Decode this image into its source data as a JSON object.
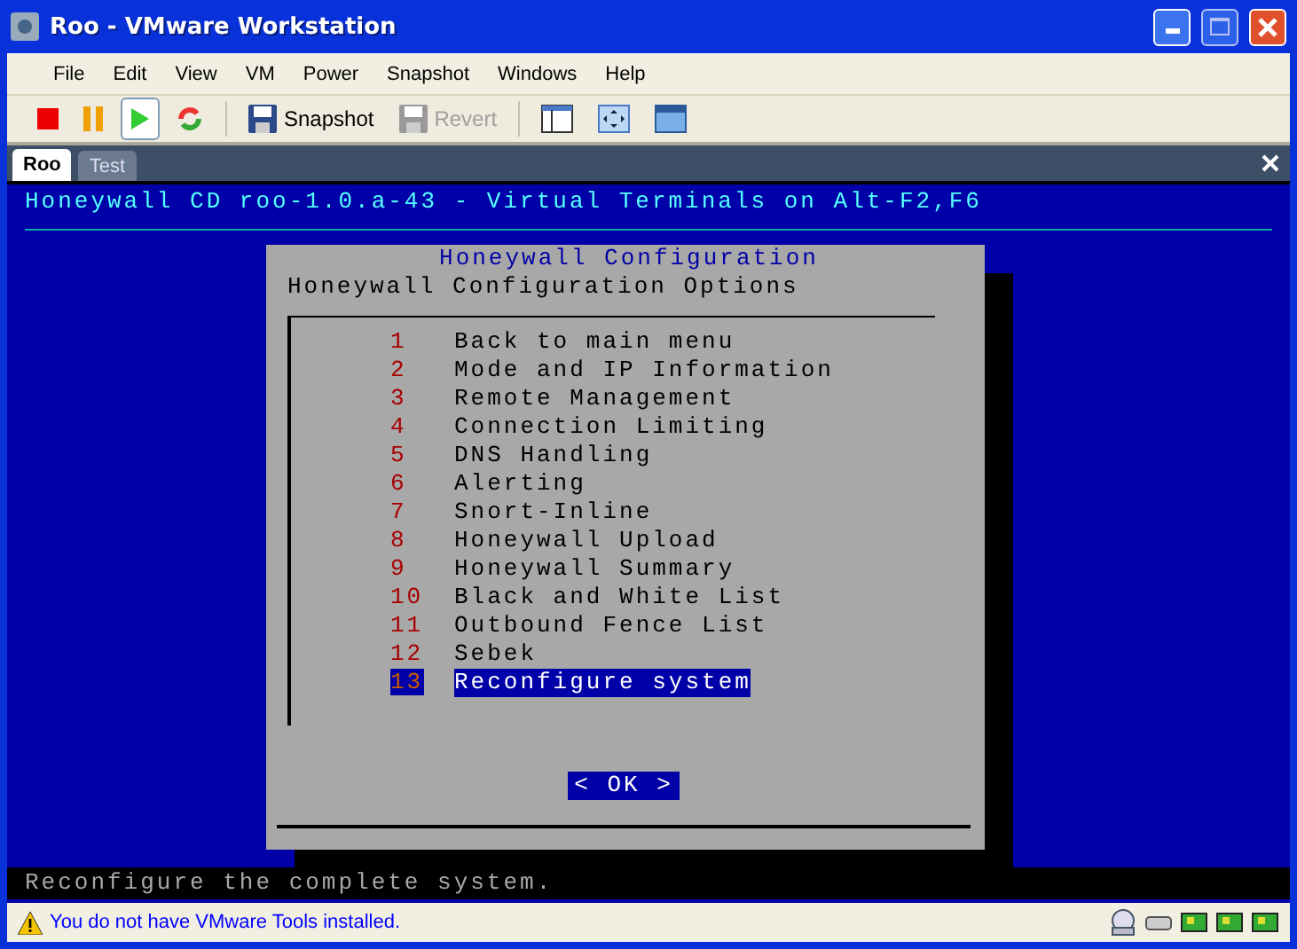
{
  "window": {
    "title": "Roo - VMware Workstation"
  },
  "menu": [
    "File",
    "Edit",
    "View",
    "VM",
    "Power",
    "Snapshot",
    "Windows",
    "Help"
  ],
  "toolbar": [
    {
      "kind": "stop"
    },
    {
      "kind": "pause"
    },
    {
      "kind": "play"
    },
    {
      "kind": "reset"
    },
    {
      "kind": "snapshot",
      "label": "Snapshot",
      "disabled": false
    },
    {
      "kind": "revert",
      "label": "Revert",
      "disabled": true
    },
    {
      "kind": "sidebar"
    },
    {
      "kind": "fullscreen"
    },
    {
      "kind": "window"
    }
  ],
  "tabs": [
    {
      "label": "Roo",
      "selected": true
    },
    {
      "label": "Test",
      "selected": false
    }
  ],
  "terminal": {
    "header": "Honeywall CD roo-1.0.a-43 - Virtual Terminals on Alt-F2,F6",
    "dialog": {
      "title": "Honeywall Configuration",
      "subtitle": "Honeywall Configuration Options",
      "items": [
        {
          "number": "1",
          "label": "Back to main menu",
          "selected": false
        },
        {
          "number": "2",
          "label": "Mode and IP Information",
          "selected": false
        },
        {
          "number": "3",
          "label": "Remote Management",
          "selected": false
        },
        {
          "number": "4",
          "label": "Connection Limiting",
          "selected": false
        },
        {
          "number": "5",
          "label": "DNS Handling",
          "selected": false
        },
        {
          "number": "6",
          "label": "Alerting",
          "selected": false
        },
        {
          "number": "7",
          "label": "Snort-Inline",
          "selected": false
        },
        {
          "number": "8",
          "label": "Honeywall Upload",
          "selected": false
        },
        {
          "number": "9",
          "label": "Honeywall Summary",
          "selected": false
        },
        {
          "number": "10",
          "label": "Black and White List",
          "selected": false
        },
        {
          "number": "11",
          "label": "Outbound Fence List",
          "selected": false
        },
        {
          "number": "12",
          "label": "Sebek",
          "selected": false
        },
        {
          "number": "13",
          "label": "Reconfigure system",
          "selected": true
        }
      ],
      "ok": {
        "left": "<",
        "label": "OK",
        "right": ">"
      }
    },
    "help_line": "Reconfigure the complete system."
  },
  "status_bar": {
    "message": "You do not have VMware Tools installed."
  }
}
